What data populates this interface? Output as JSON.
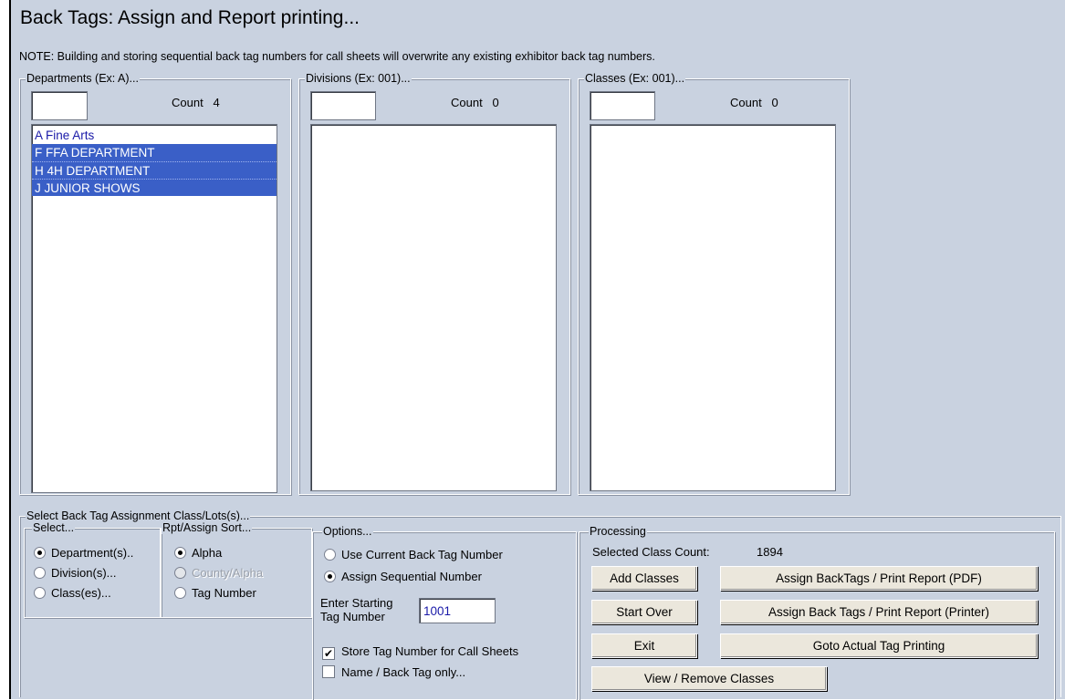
{
  "window": {
    "title": "Back Tags: Assign and Report printing...",
    "note": "NOTE:  Building and storing sequential back tag numbers for call sheets will overwrite any existing exhibitor back tag numbers."
  },
  "departments": {
    "legend": "Departments  (Ex: A)...",
    "count_label": "Count",
    "count": "4",
    "filter_value": "",
    "items": [
      {
        "label": "A  Fine Arts",
        "selected": false
      },
      {
        "label": "F  FFA DEPARTMENT",
        "selected": true
      },
      {
        "label": "H  4H DEPARTMENT",
        "selected": true
      },
      {
        "label": "J  JUNIOR SHOWS",
        "selected": true
      }
    ]
  },
  "divisions": {
    "legend": "Divisions  (Ex: 001)...",
    "count_label": "Count",
    "count": "0",
    "filter_value": ""
  },
  "classes": {
    "legend": "Classes  (Ex: 001)...",
    "count_label": "Count",
    "count": "0",
    "filter_value": ""
  },
  "assignment": {
    "legend": "Select Back Tag Assignment Class/Lots(s)...",
    "select": {
      "legend": "Select...",
      "options": [
        {
          "label": "Department(s)..",
          "checked": true
        },
        {
          "label": "Division(s)...",
          "checked": false
        },
        {
          "label": "Class(es)...",
          "checked": false
        }
      ]
    },
    "sort": {
      "legend": "Rpt/Assign  Sort...",
      "options": [
        {
          "label": "Alpha",
          "checked": true,
          "disabled": false
        },
        {
          "label": "County/Alpha",
          "checked": false,
          "disabled": true
        },
        {
          "label": "Tag Number",
          "checked": false,
          "disabled": false
        }
      ]
    }
  },
  "options": {
    "legend": "Options...",
    "radios": [
      {
        "label": "Use Current Back Tag Number",
        "checked": false
      },
      {
        "label": "Assign Sequential Number",
        "checked": true
      }
    ],
    "starting_label_1": "Enter Starting",
    "starting_label_2": "Tag Number",
    "starting_value": "1001",
    "checkboxes": [
      {
        "label": "Store Tag Number for Call Sheets",
        "checked": true
      },
      {
        "label": "Name / Back Tag only...",
        "checked": false
      }
    ]
  },
  "processing": {
    "legend": "Processing",
    "count_label": "Selected Class Count:",
    "count_value": "1894",
    "buttons": {
      "add": "Add Classes",
      "start_over": "Start Over",
      "exit": "Exit",
      "assign_pdf": "Assign BackTags / Print Report (PDF)",
      "assign_printer": "Assign Back Tags / Print Report (Printer)",
      "goto_printing": "Goto Actual Tag Printing",
      "view_remove": "View / Remove Classes"
    }
  },
  "colors": {
    "window_bg": "#c9d2e0",
    "selection_bg": "#3a5fc7",
    "list_text": "#1a1aa8",
    "button_bg": "#ebe7dc"
  }
}
